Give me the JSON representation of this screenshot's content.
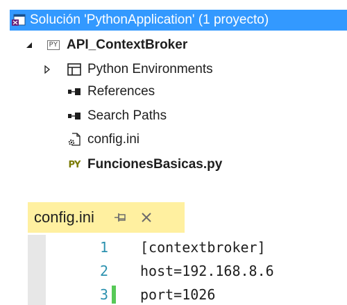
{
  "solution_explorer": {
    "solution_label": "Solución 'PythonApplication' (1 proyecto)",
    "project": {
      "label": "API_ContextBroker",
      "badge": "PY"
    },
    "items": [
      {
        "label": "Python Environments",
        "icon": "environments-icon"
      },
      {
        "label": "References",
        "icon": "references-icon"
      },
      {
        "label": "Search Paths",
        "icon": "search-paths-icon"
      },
      {
        "label": "config.ini",
        "icon": "config-file-icon"
      },
      {
        "label": "FuncionesBasicas.py",
        "icon": "python-file-icon",
        "badge": "PY"
      }
    ]
  },
  "editor": {
    "tab": {
      "title": "config.ini",
      "pin_glyph": "⊣",
      "close_glyph": "✕"
    },
    "lines": [
      {
        "number": "1",
        "text": "[contextbroker]"
      },
      {
        "number": "2",
        "text": "host=192.168.8.6"
      },
      {
        "number": "3",
        "text": "port=1026"
      }
    ]
  },
  "colors": {
    "selection": "#3399ff",
    "tab_active": "#fff0a0",
    "line_number": "#2b91af",
    "change_marker": "#57c957"
  }
}
